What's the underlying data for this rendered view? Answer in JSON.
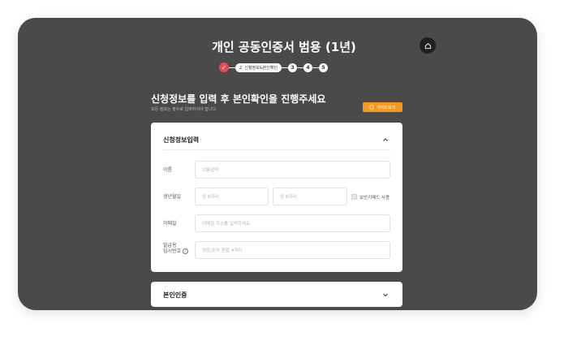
{
  "header": {
    "title": "개인 공동인증서 범용 (1년)",
    "home_icon": "home-icon"
  },
  "steps": {
    "done_icon": "check-icon",
    "current_label": "2. 신청정보&본인확인",
    "step3": "3",
    "step4": "4",
    "step5": "5",
    "done_color": "#e84b50"
  },
  "intro": {
    "heading": "신청정보를 입력 후 본인확인을 진행주세요",
    "subheading": "모든 정보는 필수로 입력하셔야 합니다.",
    "guide_button": "가이드보기",
    "guide_color": "#f59a1b"
  },
  "form": {
    "title": "신청정보입력",
    "name_label": "이름",
    "name_placeholder": "이름입력",
    "birth_label": "생년월일",
    "birth_front_placeholder": "앞 6자리",
    "birth_back_placeholder": "앞 6자리",
    "secure_keypad_label": "보안키패드 사용",
    "email_label": "이메일",
    "email_placeholder": "이메일 주소를 입력하세요",
    "pin_label_line1": "발급용",
    "pin_label_line2": "임시번호",
    "pin_placeholder": "영문/숫자 혼합 4자리"
  },
  "verify": {
    "title": "본인인증"
  }
}
